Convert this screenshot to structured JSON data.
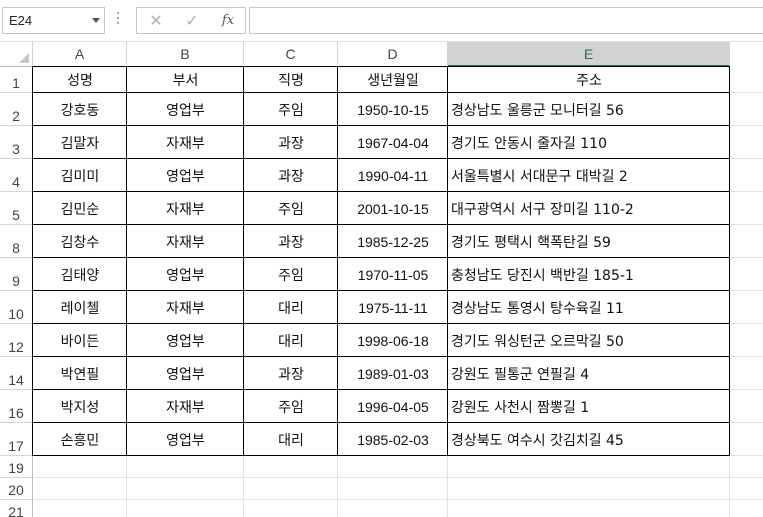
{
  "name_box": {
    "value": "E24"
  },
  "formula_bar": {
    "cancel_icon": "✕",
    "enter_icon": "✓",
    "fx_label": "fx",
    "content": ""
  },
  "columns": [
    "A",
    "B",
    "C",
    "D",
    "E"
  ],
  "selected_column": "E",
  "rows": [
    "1",
    "2",
    "3",
    "4",
    "5",
    "8",
    "9",
    "10",
    "12",
    "14",
    "16",
    "17",
    "19",
    "20",
    "21"
  ],
  "table": {
    "headers": [
      "성명",
      "부서",
      "직명",
      "생년월일",
      "주소"
    ],
    "records": [
      [
        "강호동",
        "영업부",
        "주임",
        "1950-10-15",
        "경상남도 울릉군 모니터길 56"
      ],
      [
        "김말자",
        "자재부",
        "과장",
        "1967-04-04",
        "경기도 안동시 줄자길 110"
      ],
      [
        "김미미",
        "영업부",
        "과장",
        "1990-04-11",
        "서울특별시 서대문구 대박길 2"
      ],
      [
        "김민순",
        "자재부",
        "주임",
        "2001-10-15",
        "대구광역시 서구 장미길 110-2"
      ],
      [
        "김창수",
        "자재부",
        "과장",
        "1985-12-25",
        "경기도 평택시 핵폭탄길 59"
      ],
      [
        "김태양",
        "영업부",
        "주임",
        "1970-11-05",
        "충청남도 당진시 백반길 185-1"
      ],
      [
        "레이첼",
        "자재부",
        "대리",
        "1975-11-11",
        "경상남도 통영시 탕수육길 11"
      ],
      [
        "바이든",
        "영업부",
        "대리",
        "1998-06-18",
        "경기도 워싱턴군 오르막길 50"
      ],
      [
        "박연필",
        "영업부",
        "과장",
        "1989-01-03",
        "강원도 필통군 연필길 4"
      ],
      [
        "박지성",
        "자재부",
        "주임",
        "1996-04-05",
        "강원도 사천시 짬뽕길 1"
      ],
      [
        "손흥민",
        "영업부",
        "대리",
        "1985-02-03",
        "경상북도 여수시 갓김치길 45"
      ]
    ]
  },
  "colors": {
    "accent": "#217346",
    "header_selected_bg": "#d2d2d2",
    "gridline": "#e1e1e1",
    "table_border": "#000000"
  }
}
